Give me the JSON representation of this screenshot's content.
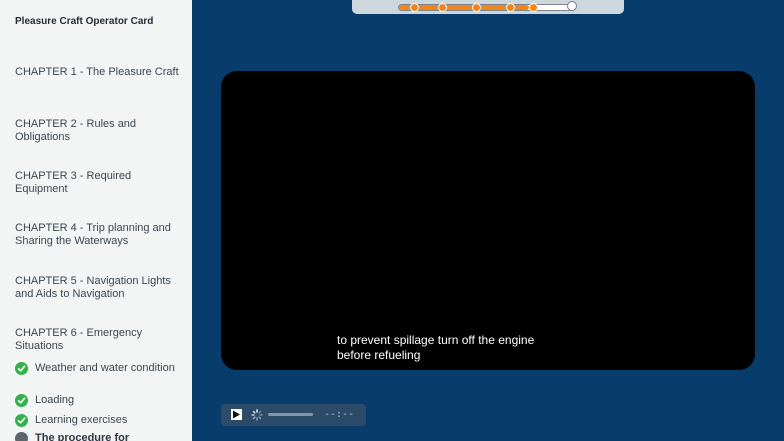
{
  "sidebar": {
    "title": "Pleasure Craft Operator Card",
    "chapters": [
      {
        "label": "CHAPTER 1 - The Pleasure Craft"
      },
      {
        "label": "CHAPTER 2 - Rules and Obligations"
      },
      {
        "label": "CHAPTER 3 - Required Equipment"
      },
      {
        "label": "CHAPTER 4 - Trip planning and Sharing the Waterways"
      },
      {
        "label": "CHAPTER 5 - Navigation Lights and Aids to Navigation"
      },
      {
        "label": "CHAPTER 6 - Emergency Situations"
      }
    ],
    "lessons": [
      {
        "label": "Weather and water condition",
        "status": "complete"
      },
      {
        "label": "Loading",
        "status": "complete"
      },
      {
        "label": "Learning exercises",
        "status": "complete"
      },
      {
        "label": "The procedure for",
        "status": "current"
      }
    ]
  },
  "progress": {
    "fraction": 0.74,
    "markers": 5
  },
  "video": {
    "caption_line1": "to prevent spillage turn off the engine",
    "caption_line2": "before refueling"
  },
  "controls": {
    "time": "--:--",
    "icons": [
      "play-icon",
      "loading-spinner-icon"
    ]
  },
  "colors": {
    "background": "#083d6b",
    "sidebar": "#f3f5f5",
    "accent": "#f0861c",
    "complete": "#33b14b"
  }
}
